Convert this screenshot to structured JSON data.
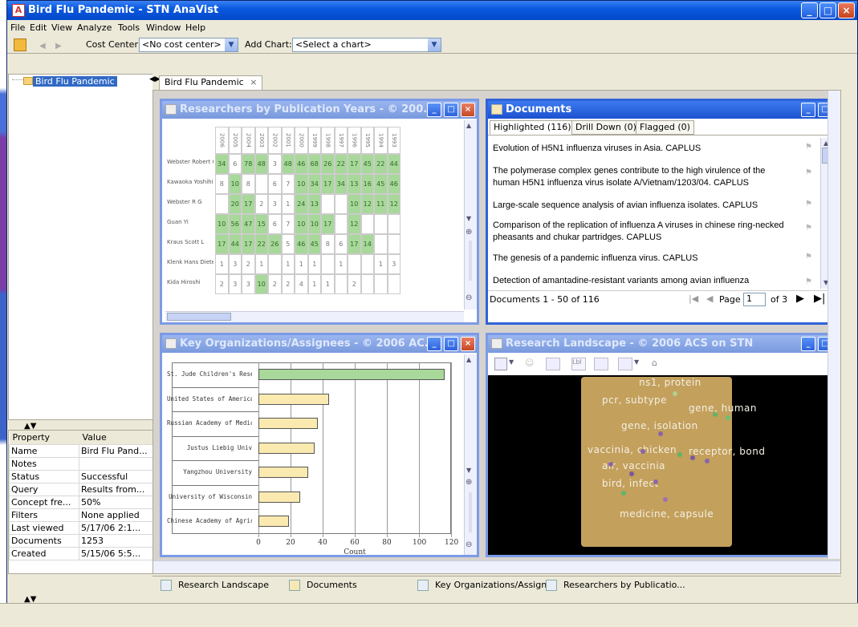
{
  "window": {
    "title": "Bird Flu Pandemic - STN AnaVist"
  },
  "menu": [
    "File",
    "Edit",
    "View",
    "Analyze",
    "Tools",
    "Window",
    "Help"
  ],
  "toolbar": {
    "cost_center_label": "Cost Center:",
    "cost_center_value": "<No cost center>",
    "add_chart_label": "Add Chart:",
    "add_chart_value": "<Select a chart>"
  },
  "tree": {
    "root": "Bird Flu Pandemic"
  },
  "properties": {
    "headers": [
      "Property",
      "Value"
    ],
    "rows": [
      [
        "Name",
        "Bird Flu Pand..."
      ],
      [
        "Notes",
        ""
      ],
      [
        "Status",
        "Successful"
      ],
      [
        "Query",
        "Results from..."
      ],
      [
        "Concept fre...",
        "50%"
      ],
      [
        "Filters",
        "None applied"
      ],
      [
        "Last viewed",
        "5/17/06 2:1..."
      ],
      [
        "Documents",
        "1253"
      ],
      [
        "Created",
        "5/15/06 5:5..."
      ]
    ]
  },
  "main_tab": "Bird Flu Pandemic",
  "panels": {
    "researchers": {
      "title": "Researchers by Publication Years - © 200...",
      "years": [
        "2006",
        "2005",
        "2004",
        "2003",
        "2002",
        "2001",
        "2000",
        "1999",
        "1998",
        "1997",
        "1996",
        "1995",
        "1994",
        "1993"
      ],
      "rows": [
        {
          "name": "Webster Robert G",
          "cells": [
            "34",
            "6",
            "78",
            "48",
            "3",
            "48",
            "46",
            "68",
            "26",
            "22",
            "17",
            "45",
            "22",
            "44"
          ]
        },
        {
          "name": "Kawaoka Yoshihiro",
          "cells": [
            "8",
            "10",
            "8",
            "",
            "6",
            "7",
            "10",
            "34",
            "17",
            "34",
            "13",
            "16",
            "45",
            "46"
          ]
        },
        {
          "name": "Webster R G",
          "cells": [
            "",
            "20",
            "17",
            "2",
            "3",
            "1",
            "24",
            "13",
            "",
            "",
            "10",
            "12",
            "11",
            "12"
          ]
        },
        {
          "name": "Guan Yi",
          "cells": [
            "10",
            "56",
            "47",
            "15",
            "6",
            "7",
            "10",
            "10",
            "17",
            "",
            "12",
            "",
            "",
            ""
          ]
        },
        {
          "name": "Kraus Scott L",
          "cells": [
            "17",
            "44",
            "17",
            "22",
            "26",
            "5",
            "46",
            "45",
            "8",
            "6",
            "17",
            "14",
            "",
            ""
          ]
        },
        {
          "name": "Klenk Hans Dieter",
          "cells": [
            "1",
            "3",
            "2",
            "1",
            "",
            "1",
            "1",
            "1",
            "",
            "1",
            "",
            "",
            "1",
            "3"
          ]
        },
        {
          "name": "Kida Hiroshi",
          "cells": [
            "2",
            "3",
            "3",
            "10",
            "2",
            "2",
            "4",
            "1",
            "1",
            "",
            "2",
            "",
            "",
            ""
          ]
        }
      ]
    },
    "documents": {
      "title": "Documents",
      "tabs": [
        "Highlighted (116)",
        "Drill Down (0)",
        "Flagged (0)"
      ],
      "items": [
        "Evolution of H5N1 influenza viruses in Asia. CAPLUS",
        "The polymerase complex genes contribute to the high virulence of the human H5N1 influenza virus isolate A/Vietnam/1203/04. CAPLUS",
        "Large-scale sequence analysis of avian influenza isolates. CAPLUS",
        "Comparison of the replication of influenza A viruses in chinese ring-necked pheasants and chukar partridges. CAPLUS",
        "The genesis of a pandemic influenza virus. CAPLUS",
        "Detection of amantadine-resistant variants among avian influenza"
      ],
      "footer_range": "Documents 1 - 50 of 116",
      "page_label": "Page",
      "page_value": "1",
      "page_of": "of 3"
    },
    "orgs": {
      "title": "Key Organizations/Assignees - © 2006 AC..."
    },
    "landscape": {
      "title": "Research Landscape - © 2006 ACS on STN",
      "terms": [
        "ns1, protein",
        "pcr, subtype",
        "gene, human",
        "gene, isolation",
        "vaccinia, chicken",
        "receptor, bond",
        "air, vaccinia",
        "bird, infect",
        "medicine, capsule"
      ]
    }
  },
  "chart_data": {
    "type": "bar",
    "orientation": "horizontal",
    "categories": [
      "St. Jude Children's Resea...",
      "United States of America,...",
      "Russian Academy of Medic...",
      "Justus Liebig Univ",
      "Yangzhou University",
      "University of Wisconsin",
      "Chinese Academy of Agricu..."
    ],
    "values": [
      116,
      44,
      37,
      35,
      31,
      26,
      19
    ],
    "xlabel": "Count",
    "xlim": [
      0,
      120
    ],
    "xticks": [
      0,
      20,
      40,
      60,
      80,
      100,
      120
    ],
    "grid": true,
    "colors": {
      "highlight": "#a8d89a",
      "default": "#fbeab0"
    }
  },
  "bottom_tabs": [
    "Research Landscape",
    "Documents",
    "Key Organizations/Assign...",
    "Researchers by Publicatio..."
  ]
}
